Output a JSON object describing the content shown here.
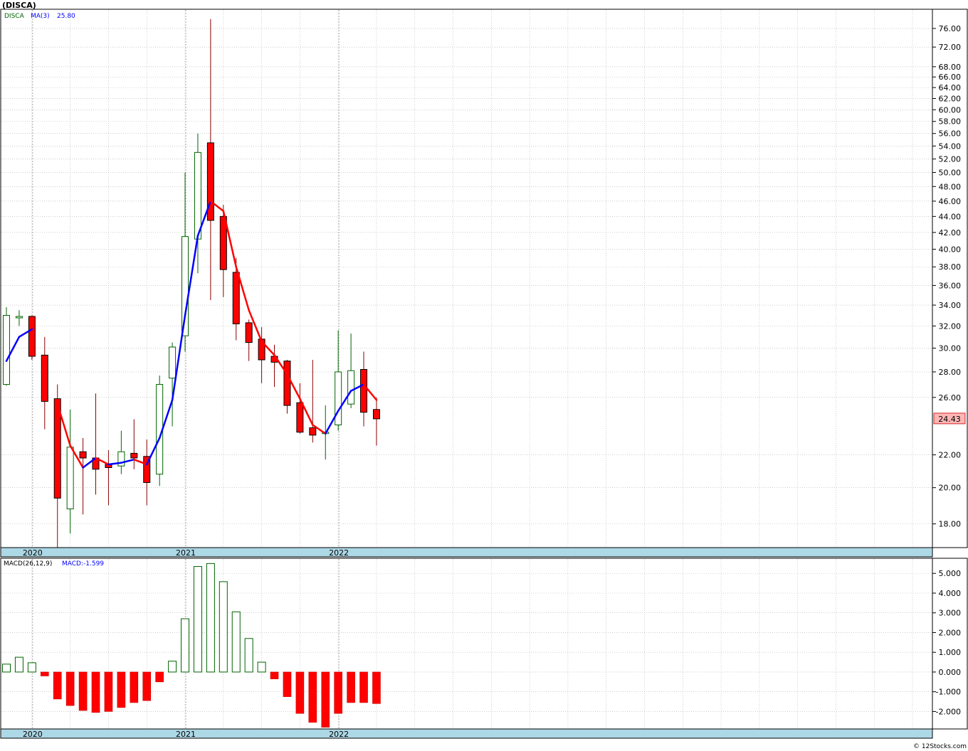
{
  "header": {
    "title": "(DISCA)"
  },
  "footer": {
    "copyright": "© 12Stocks.com"
  },
  "colors": {
    "up": "#006400",
    "down": "#ff0000",
    "ma_up": "#0000ff",
    "ma_down": "#ff0000",
    "axis_band": "#add8e6",
    "grid": "#b0b0b0"
  },
  "chart_data": [
    {
      "type": "candlestick",
      "legend": {
        "symbol": "DISCA",
        "ma_label": "MA(3)",
        "ma_value": "25.80"
      },
      "y_scale": "log",
      "ylim": [
        16.8,
        80.2
      ],
      "y_ticks": [
        {
          "v": 18,
          "label": "18.00"
        },
        {
          "v": 20,
          "label": "20.00"
        },
        {
          "v": 22,
          "label": "22.00"
        },
        {
          "v": 26,
          "label": "26.00"
        },
        {
          "v": 28,
          "label": "28.00"
        },
        {
          "v": 30,
          "label": "30.00"
        },
        {
          "v": 32,
          "label": "32.00"
        },
        {
          "v": 34,
          "label": "34.00"
        },
        {
          "v": 36,
          "label": "36.00"
        },
        {
          "v": 38,
          "label": "38.00"
        },
        {
          "v": 40,
          "label": "40.00"
        },
        {
          "v": 42,
          "label": "42.00"
        },
        {
          "v": 44,
          "label": "44.00"
        },
        {
          "v": 46,
          "label": "46.00"
        },
        {
          "v": 48,
          "label": "48.00"
        },
        {
          "v": 50,
          "label": "50.00"
        },
        {
          "v": 52,
          "label": "52.00"
        },
        {
          "v": 54,
          "label": "54.00"
        },
        {
          "v": 56,
          "label": "56.00"
        },
        {
          "v": 58,
          "label": "58.00"
        },
        {
          "v": 60,
          "label": "60.00"
        },
        {
          "v": 62,
          "label": "62.00"
        },
        {
          "v": 64,
          "label": "64.00"
        },
        {
          "v": 66,
          "label": "66.00"
        },
        {
          "v": 68,
          "label": "68.00"
        },
        {
          "v": 72,
          "label": "72.00"
        },
        {
          "v": 76,
          "label": "76.00"
        }
      ],
      "last_price": {
        "value": 24.43,
        "label": "24.43"
      },
      "x_labels": [
        {
          "index": 2,
          "label": "2020"
        },
        {
          "index": 14,
          "label": "2021"
        },
        {
          "index": 26,
          "label": "2022"
        }
      ],
      "candles": [
        {
          "date": "2019-11",
          "open": 27.0,
          "high": 33.8,
          "low": 26.9,
          "close": 33.0
        },
        {
          "date": "2019-12",
          "open": 32.8,
          "high": 33.5,
          "low": 32.0,
          "close": 32.9
        },
        {
          "date": "2020-01",
          "open": 32.9,
          "high": 33.0,
          "low": 29.0,
          "close": 29.3
        },
        {
          "date": "2020-02",
          "open": 29.4,
          "high": 31.0,
          "low": 23.7,
          "close": 25.7
        },
        {
          "date": "2020-03",
          "open": 25.9,
          "high": 27.0,
          "low": 16.8,
          "close": 19.4
        },
        {
          "date": "2020-04",
          "open": 18.8,
          "high": 25.1,
          "low": 17.5,
          "close": 22.5
        },
        {
          "date": "2020-05",
          "open": 22.2,
          "high": 23.1,
          "low": 18.5,
          "close": 21.8
        },
        {
          "date": "2020-06",
          "open": 21.8,
          "high": 26.3,
          "low": 19.6,
          "close": 21.1
        },
        {
          "date": "2020-07",
          "open": 21.4,
          "high": 22.3,
          "low": 19.0,
          "close": 21.2
        },
        {
          "date": "2020-08",
          "open": 21.3,
          "high": 23.6,
          "low": 20.8,
          "close": 22.2
        },
        {
          "date": "2020-09",
          "open": 22.1,
          "high": 24.4,
          "low": 21.1,
          "close": 21.8
        },
        {
          "date": "2020-10",
          "open": 21.9,
          "high": 23.0,
          "low": 19.0,
          "close": 20.3
        },
        {
          "date": "2020-11",
          "open": 20.8,
          "high": 27.7,
          "low": 20.1,
          "close": 27.0
        },
        {
          "date": "2020-12",
          "open": 27.5,
          "high": 30.5,
          "low": 23.9,
          "close": 30.1
        },
        {
          "date": "2021-01",
          "open": 31.1,
          "high": 50.0,
          "low": 29.7,
          "close": 41.5
        },
        {
          "date": "2021-02",
          "open": 41.2,
          "high": 56.0,
          "low": 37.3,
          "close": 53.0
        },
        {
          "date": "2021-03",
          "open": 54.5,
          "high": 78.1,
          "low": 34.5,
          "close": 43.5
        },
        {
          "date": "2021-04",
          "open": 44.0,
          "high": 45.5,
          "low": 34.8,
          "close": 37.7
        },
        {
          "date": "2021-05",
          "open": 37.4,
          "high": 39.0,
          "low": 30.7,
          "close": 32.2
        },
        {
          "date": "2021-06",
          "open": 32.3,
          "high": 32.6,
          "low": 28.9,
          "close": 30.5
        },
        {
          "date": "2021-07",
          "open": 30.8,
          "high": 31.9,
          "low": 27.1,
          "close": 29.0
        },
        {
          "date": "2021-08",
          "open": 29.3,
          "high": 30.3,
          "low": 26.8,
          "close": 28.8
        },
        {
          "date": "2021-09",
          "open": 28.9,
          "high": 29.0,
          "low": 24.8,
          "close": 25.4
        },
        {
          "date": "2021-10",
          "open": 25.6,
          "high": 27.1,
          "low": 23.4,
          "close": 23.5
        },
        {
          "date": "2021-11",
          "open": 23.8,
          "high": 29.0,
          "low": 22.8,
          "close": 23.3
        },
        {
          "date": "2021-12",
          "open": 23.4,
          "high": 25.4,
          "low": 21.7,
          "close": 23.5
        },
        {
          "date": "2022-01",
          "open": 24.0,
          "high": 31.6,
          "low": 23.6,
          "close": 28.0
        },
        {
          "date": "2022-02",
          "open": 25.5,
          "high": 31.3,
          "low": 25.2,
          "close": 28.1
        },
        {
          "date": "2022-03",
          "open": 28.2,
          "high": 29.7,
          "low": 23.9,
          "close": 24.9
        },
        {
          "date": "2022-04",
          "open": 25.1,
          "high": 26.0,
          "low": 22.6,
          "close": 24.43
        }
      ],
      "ma": [
        28.9,
        31.0,
        31.7,
        null,
        25.5,
        22.6,
        21.2,
        21.8,
        21.4,
        21.5,
        21.7,
        21.4,
        23.1,
        25.8,
        33.0,
        41.6,
        46.0,
        44.7,
        38.0,
        33.5,
        30.6,
        29.4,
        27.8,
        25.9,
        24.0,
        23.4,
        25.0,
        26.5,
        27.0,
        25.8
      ]
    },
    {
      "type": "bar",
      "legend": {
        "indicator": "MACD(26,12,9)",
        "value_label": "MACD:-1.599"
      },
      "ylim": [
        -2.85,
        5.73
      ],
      "y_ticks": [
        {
          "v": -2,
          "label": "-2.000"
        },
        {
          "v": -1,
          "label": "-1.000"
        },
        {
          "v": 0,
          "label": "0.000"
        },
        {
          "v": 1,
          "label": "1.000"
        },
        {
          "v": 2,
          "label": "2.000"
        },
        {
          "v": 3,
          "label": "3.000"
        },
        {
          "v": 4,
          "label": "4.000"
        },
        {
          "v": 5,
          "label": "5.000"
        }
      ],
      "x_labels": [
        {
          "index": 2,
          "label": "2020"
        },
        {
          "index": 14,
          "label": "2021"
        },
        {
          "index": 26,
          "label": "2022"
        }
      ],
      "values": [
        0.4,
        0.75,
        0.47,
        -0.2,
        -1.37,
        -1.7,
        -1.95,
        -2.05,
        -2.0,
        -1.8,
        -1.55,
        -1.45,
        -0.5,
        0.55,
        2.7,
        5.35,
        5.5,
        4.58,
        3.05,
        1.7,
        0.5,
        -0.35,
        -1.25,
        -2.1,
        -2.55,
        -2.8,
        -2.1,
        -1.55,
        -1.55,
        -1.6
      ]
    }
  ]
}
